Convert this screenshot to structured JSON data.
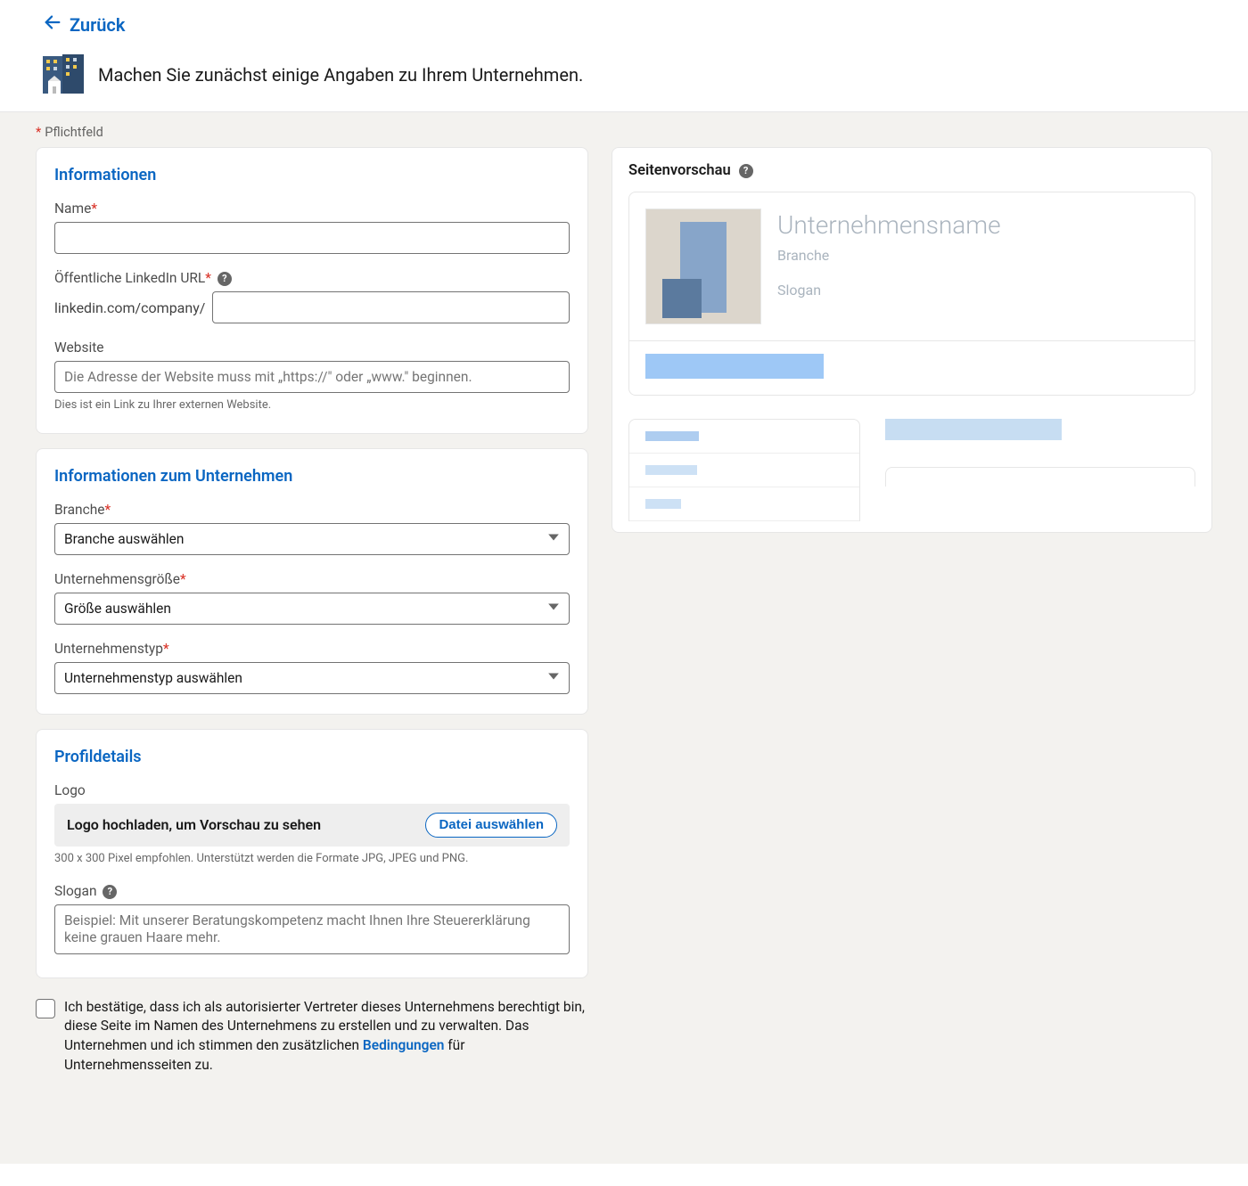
{
  "header": {
    "back_label": "Zurück",
    "title": "Machen Sie zunächst einige Angaben zu Ihrem Unternehmen."
  },
  "required_note": "Pflichtfeld",
  "sections": {
    "info": {
      "heading": "Informationen",
      "name_label": "Name",
      "url_label": "Öffentliche LinkedIn URL",
      "url_prefix": "linkedin.com/company/",
      "website_label": "Website",
      "website_placeholder": "Die Adresse der Website muss mit „https://\" oder „www.\" beginnen.",
      "website_hint": "Dies ist ein Link zu Ihrer externen Website."
    },
    "company": {
      "heading": "Informationen zum Unternehmen",
      "branch_label": "Branche",
      "branch_placeholder": "Branche auswählen",
      "size_label": "Unternehmensgröße",
      "size_placeholder": "Größe auswählen",
      "type_label": "Unternehmenstyp",
      "type_placeholder": "Unternehmenstyp auswählen"
    },
    "profile": {
      "heading": "Profildetails",
      "logo_label": "Logo",
      "logo_upload_text": "Logo hochladen, um Vorschau zu sehen",
      "file_button": "Datei auswählen",
      "logo_hint": "300 x 300 Pixel empfohlen. Unterstützt werden die Formate JPG, JPEG und PNG.",
      "slogan_label": "Slogan",
      "slogan_placeholder": "Beispiel: Mit unserer Beratungskompetenz macht Ihnen Ihre Steuererklärung keine grauen Haare mehr."
    }
  },
  "confirm": {
    "text_before": "Ich bestätige, dass ich als autorisierter Vertreter dieses Unternehmens berechtigt bin, diese Seite im Namen des Unternehmens zu erstellen und zu verwalten. Das Unternehmen und ich stimmen den zusätzlichen ",
    "link": "Bedingungen",
    "text_after": " für Unternehmensseiten zu."
  },
  "preview": {
    "heading": "Seitenvorschau",
    "company_name": "Unternehmensname",
    "branch": "Branche",
    "slogan": "Slogan"
  }
}
